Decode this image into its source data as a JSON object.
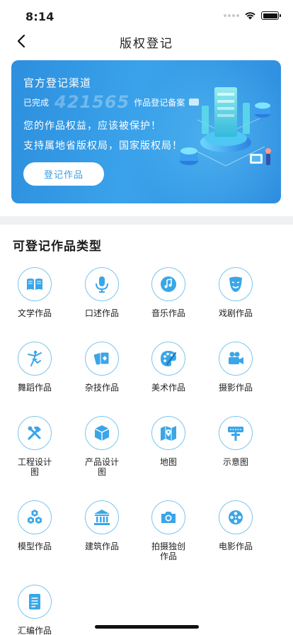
{
  "status_bar": {
    "time": "8:14"
  },
  "nav": {
    "title": "版权登记"
  },
  "banner": {
    "title": "官方登记渠道",
    "count_prefix": "已完成",
    "count": "421565",
    "count_suffix": "作品登记备案",
    "line1": "您的作品权益，应该被保护！",
    "line2": "支持属地省版权局，国家版权局！",
    "button_label": "登记作品"
  },
  "section": {
    "title": "可登记作品类型"
  },
  "work_types": [
    {
      "label": "文学作品",
      "icon": "book-icon"
    },
    {
      "label": "口述作品",
      "icon": "microphone-icon"
    },
    {
      "label": "音乐作品",
      "icon": "music-note-icon"
    },
    {
      "label": "戏剧作品",
      "icon": "theater-mask-icon"
    },
    {
      "label": "舞蹈作品",
      "icon": "dancer-icon"
    },
    {
      "label": "杂技作品",
      "icon": "playing-cards-icon"
    },
    {
      "label": "美术作品",
      "icon": "palette-icon"
    },
    {
      "label": "摄影作品",
      "icon": "video-camera-icon"
    },
    {
      "label": "工程设计图",
      "icon": "tools-icon"
    },
    {
      "label": "产品设计图",
      "icon": "cube-icon"
    },
    {
      "label": "地图",
      "icon": "map-icon"
    },
    {
      "label": "示意图",
      "icon": "signpost-icon"
    },
    {
      "label": "模型作品",
      "icon": "hexagons-icon"
    },
    {
      "label": "建筑作品",
      "icon": "building-icon"
    },
    {
      "label": "拍摄独创作品",
      "icon": "camera-icon"
    },
    {
      "label": "电影作品",
      "icon": "film-reel-icon"
    },
    {
      "label": "汇编作品",
      "icon": "document-icon"
    }
  ],
  "colors": {
    "accent": "#2f9ae4",
    "icon_border": "#7cc5ec",
    "icon_fill": "#3aa6e8"
  }
}
